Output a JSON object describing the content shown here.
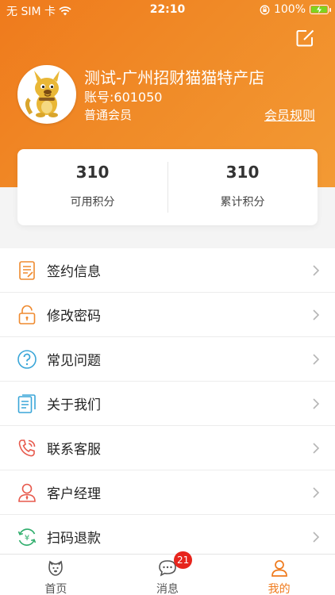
{
  "status_bar": {
    "carrier": "无 SIM 卡",
    "time": "22:10",
    "battery": "100%"
  },
  "profile": {
    "store_name": "测试-广州招财猫猫特产店",
    "account": "账号:601050",
    "member_level": "普通会员",
    "member_rules_link": "会员规则"
  },
  "points": {
    "available_value": "310",
    "available_label": "可用积分",
    "total_value": "310",
    "total_label": "累计积分"
  },
  "menu": [
    {
      "label": "签约信息",
      "icon": "contract-icon"
    },
    {
      "label": "修改密码",
      "icon": "lock-icon"
    },
    {
      "label": "常见问题",
      "icon": "question-icon"
    },
    {
      "label": "关于我们",
      "icon": "document-icon"
    },
    {
      "label": "联系客服",
      "icon": "phone-icon"
    },
    {
      "label": "客户经理",
      "icon": "manager-icon"
    },
    {
      "label": "扫码退款",
      "icon": "refund-icon"
    }
  ],
  "tabs": [
    {
      "label": "首页",
      "icon": "home-icon"
    },
    {
      "label": "消息",
      "icon": "message-icon",
      "badge": "21"
    },
    {
      "label": "我的",
      "icon": "profile-icon"
    }
  ],
  "colors": {
    "brand": "#ef7a1c",
    "badge": "#e7241c",
    "battery": "#7ed321"
  }
}
